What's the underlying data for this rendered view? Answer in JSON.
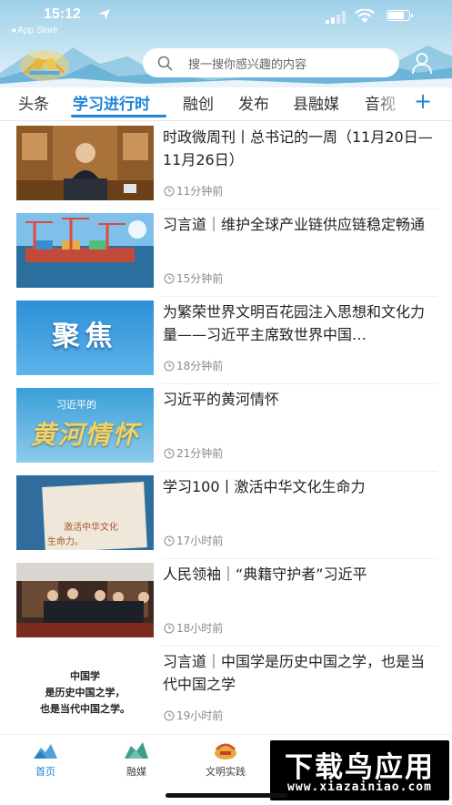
{
  "status_bar": {
    "time": "15:12",
    "back_app": "◂ App Store"
  },
  "header": {
    "search_placeholder": "搜一搜你感兴趣的内容"
  },
  "tabs": [
    {
      "label": "头条",
      "active": false
    },
    {
      "label": "学习进行时",
      "active": true
    },
    {
      "label": "融创",
      "active": false
    },
    {
      "label": "发布",
      "active": false
    },
    {
      "label": "县融媒",
      "active": false
    },
    {
      "label": "音视",
      "active": false
    }
  ],
  "tab_add_label": "+",
  "news": [
    {
      "title": "时政微周刊丨总书记的一周（11月20日—11月26日）",
      "time": "11分钟前"
    },
    {
      "title": "习言道｜维护全球产业链供应链稳定畅通",
      "time": "15分钟前"
    },
    {
      "title": "为繁荣世界文明百花园注入思想和文化力量——习近平主席致世界中国…",
      "time": "18分钟前",
      "thumb_text": "聚焦"
    },
    {
      "title": "习近平的黄河情怀",
      "time": "21分钟前",
      "thumb_text": "黄河情怀",
      "thumb_subtext": "习近平的"
    },
    {
      "title": "学习100丨激活中华文化生命力",
      "time": "17小时前",
      "thumb_text": "激活中华文化",
      "thumb_text2": "生命力。"
    },
    {
      "title": "人民领袖｜“典籍守护者”习近平",
      "time": "18小时前"
    },
    {
      "title": "习言道｜中国学是历史中国之学，也是当代中国之学",
      "time": "19小时前",
      "thumb_lines": [
        "中国学",
        "是历史中国之学，",
        "也是当代中国之学。"
      ]
    }
  ],
  "bottom_nav": [
    {
      "label": "首页",
      "icon": "home-icon",
      "active": true
    },
    {
      "label": "融媒",
      "icon": "media-icon",
      "active": false
    },
    {
      "label": "文明实践",
      "icon": "civilization-icon",
      "active": false
    }
  ],
  "watermark": {
    "main": "下载鸟应用",
    "sub": "www.xiazainiao.com"
  },
  "colors": {
    "accent": "#1e84d8",
    "header_sky": "#9fd0ea",
    "text_primary": "#222222",
    "text_muted": "#8a8a8a"
  }
}
